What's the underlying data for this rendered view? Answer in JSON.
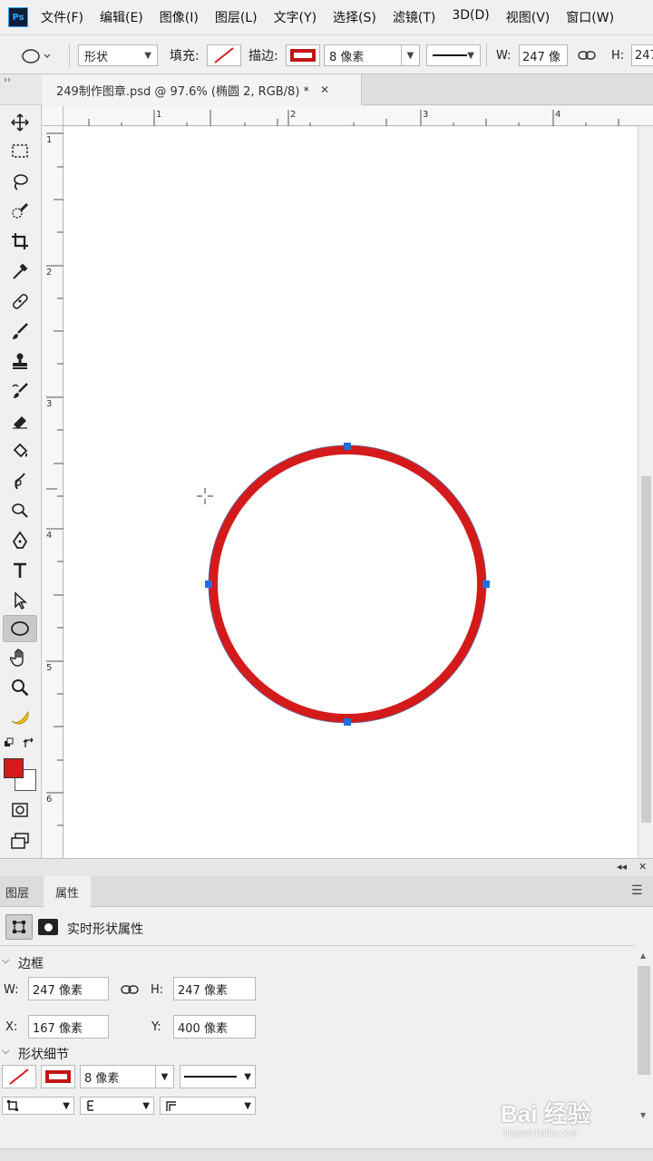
{
  "app": {
    "logo_text": "Ps"
  },
  "menu": [
    "文件(F)",
    "编辑(E)",
    "图像(I)",
    "图层(L)",
    "文字(Y)",
    "选择(S)",
    "滤镜(T)",
    "3D(D)",
    "视图(V)",
    "窗口(W)"
  ],
  "options": {
    "mode_label": "形状",
    "fill_label": "填充:",
    "stroke_label": "描边:",
    "stroke_width": "8 像素",
    "width_label": "W:",
    "width_value": "247 像",
    "height_label": "H:",
    "height_value": "247"
  },
  "toolbar_collapse": "››",
  "document": {
    "tab_title": "249制作图章.psd @ 97.6% (椭圆 2, RGB/8) *",
    "close_glyph": "✕"
  },
  "rulers": {
    "top": [
      "1",
      "2",
      "3",
      "4"
    ],
    "left": [
      "1",
      "2",
      "3",
      "4",
      "5",
      "6"
    ]
  },
  "colors": {
    "stroke": "#d41a1a",
    "anchor": "#1e6fd9",
    "foreground": "#d41a1a",
    "background": "#ffffff"
  },
  "panel": {
    "tabs": [
      "图层",
      "属性"
    ],
    "header_title": "实时形状属性",
    "section_bounds": "边框",
    "w_label": "W:",
    "w_value": "247 像素",
    "h_label": "H:",
    "h_value": "247 像素",
    "x_label": "X:",
    "x_value": "167 像素",
    "y_label": "Y:",
    "y_value": "400 像素",
    "section_details": "形状细节",
    "stroke_width": "8 像素"
  },
  "watermark": {
    "brand": "Bai 经验",
    "url": "jingyan.baidu.com"
  }
}
